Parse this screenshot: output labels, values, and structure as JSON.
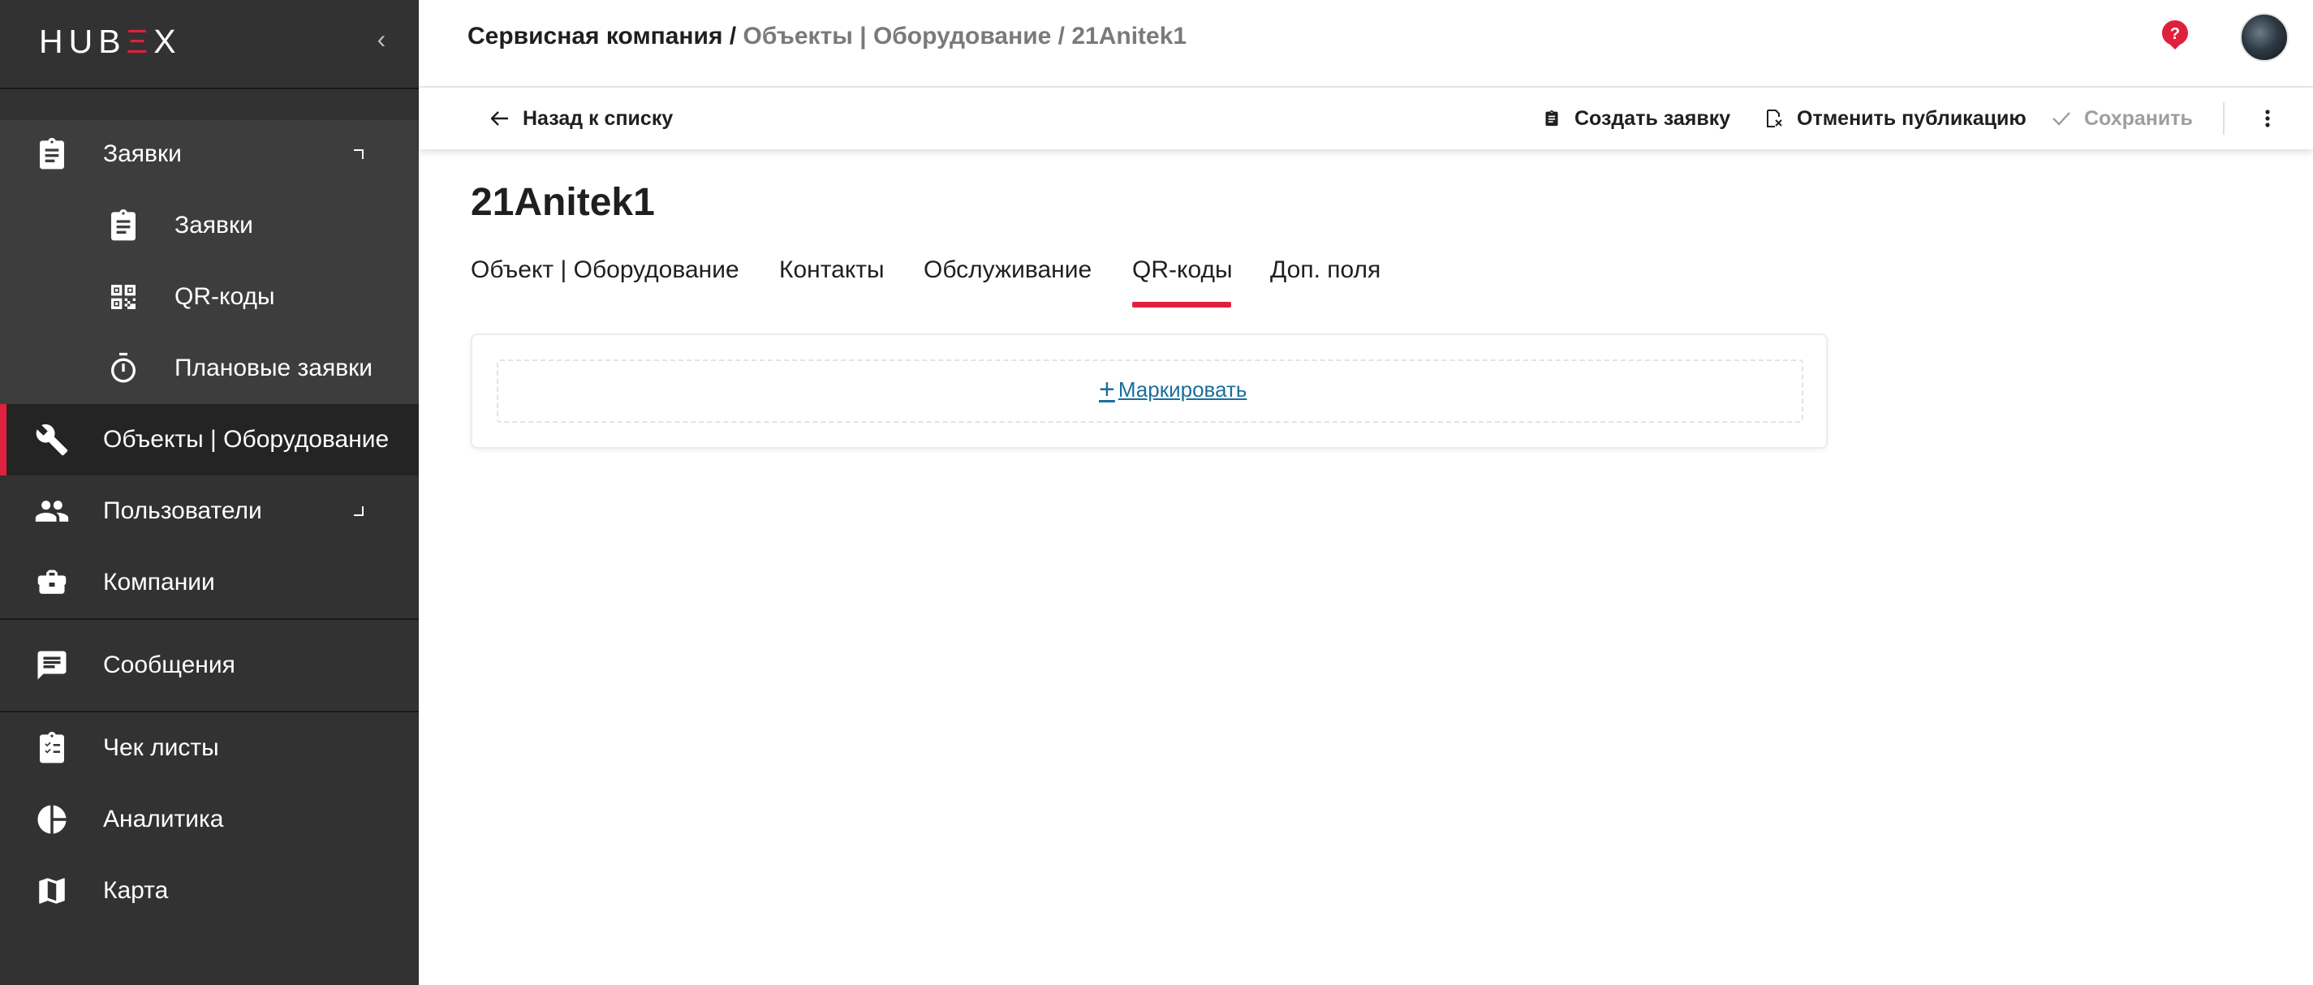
{
  "logo": {
    "text_pre": "HUB",
    "text_accent": "Ξ",
    "text_post": "X"
  },
  "sidebar": {
    "collapse_icon": "chevron-left-icon",
    "items": [
      {
        "label": "Заявки",
        "icon": "clipboard-icon"
      },
      {
        "label": "Заявки",
        "icon": "clipboard-icon"
      },
      {
        "label": "QR-коды",
        "icon": "qr-code-icon"
      },
      {
        "label": "Плановые заявки",
        "icon": "timer-icon"
      },
      {
        "label": "Объекты | Оборудование",
        "icon": "wrench-icon"
      },
      {
        "label": "Пользователи",
        "icon": "users-icon"
      },
      {
        "label": "Компании",
        "icon": "briefcase-icon"
      },
      {
        "label": "Сообщения",
        "icon": "message-icon"
      },
      {
        "label": "Чек листы",
        "icon": "checklist-icon"
      },
      {
        "label": "Аналитика",
        "icon": "pie-chart-icon"
      },
      {
        "label": "Карта",
        "icon": "map-icon"
      }
    ]
  },
  "header": {
    "breadcrumb_root": "Сервисная компания",
    "breadcrumb_sep": " / ",
    "breadcrumb_rest": "Объекты | Оборудование / 21Anitek1",
    "help_icon": "help-icon",
    "avatar_icon": "user-avatar"
  },
  "toolbar": {
    "back_label": "Назад к списку",
    "create_label": "Создать заявку",
    "unpublish_label": "Отменить публикацию",
    "save_label": "Сохранить"
  },
  "page": {
    "title": "21Anitek1"
  },
  "tabs": [
    {
      "label": "Объект | Оборудование"
    },
    {
      "label": "Контакты"
    },
    {
      "label": "Обслуживание"
    },
    {
      "label": "QR-коды",
      "active": true
    },
    {
      "label": "Доп. поля"
    }
  ],
  "qr": {
    "mark_label": "Маркировать"
  },
  "colors": {
    "accent": "#e0213d",
    "sidebar": "#323232",
    "link": "#1a6e9e"
  }
}
